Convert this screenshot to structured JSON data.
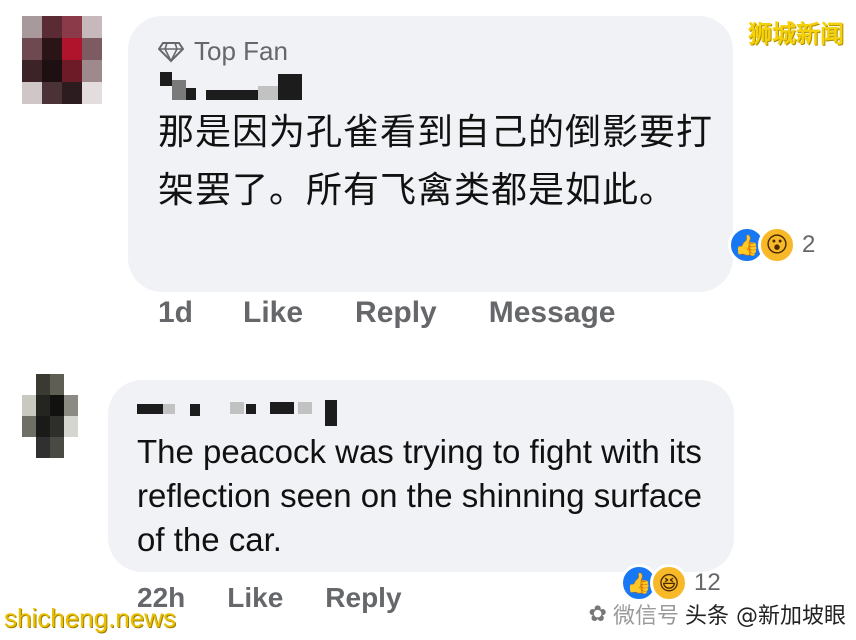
{
  "comments": [
    {
      "badge": "Top Fan",
      "text": "那是因为孔雀看到自己的倒影要打架罢了。所有飞禽类都是如此。",
      "reactions": {
        "icons": [
          "like-icon",
          "wow-icon"
        ],
        "count": "2"
      },
      "actions": {
        "time": "1d",
        "like": "Like",
        "reply": "Reply",
        "message": "Message"
      }
    },
    {
      "text": "The peacock was trying to fight with its reflection seen on the shinning surface of the car.",
      "reactions": {
        "icons": [
          "like-icon",
          "haha-icon"
        ],
        "count": "12"
      },
      "actions": {
        "time": "22h",
        "like": "Like",
        "reply": "Reply"
      }
    }
  ],
  "watermarks": {
    "top_right": "狮城新闻",
    "bottom_left": "shicheng.news",
    "bottom_right_faded": "微信号",
    "bottom_right": "头条 @新加坡眼"
  },
  "colors": {
    "bubble": "#f0f2f5",
    "meta_text": "#65676b",
    "like_blue": "#1877f2",
    "emoji_yellow": "#f7b928",
    "watermark_yellow": "#f5d10a"
  }
}
